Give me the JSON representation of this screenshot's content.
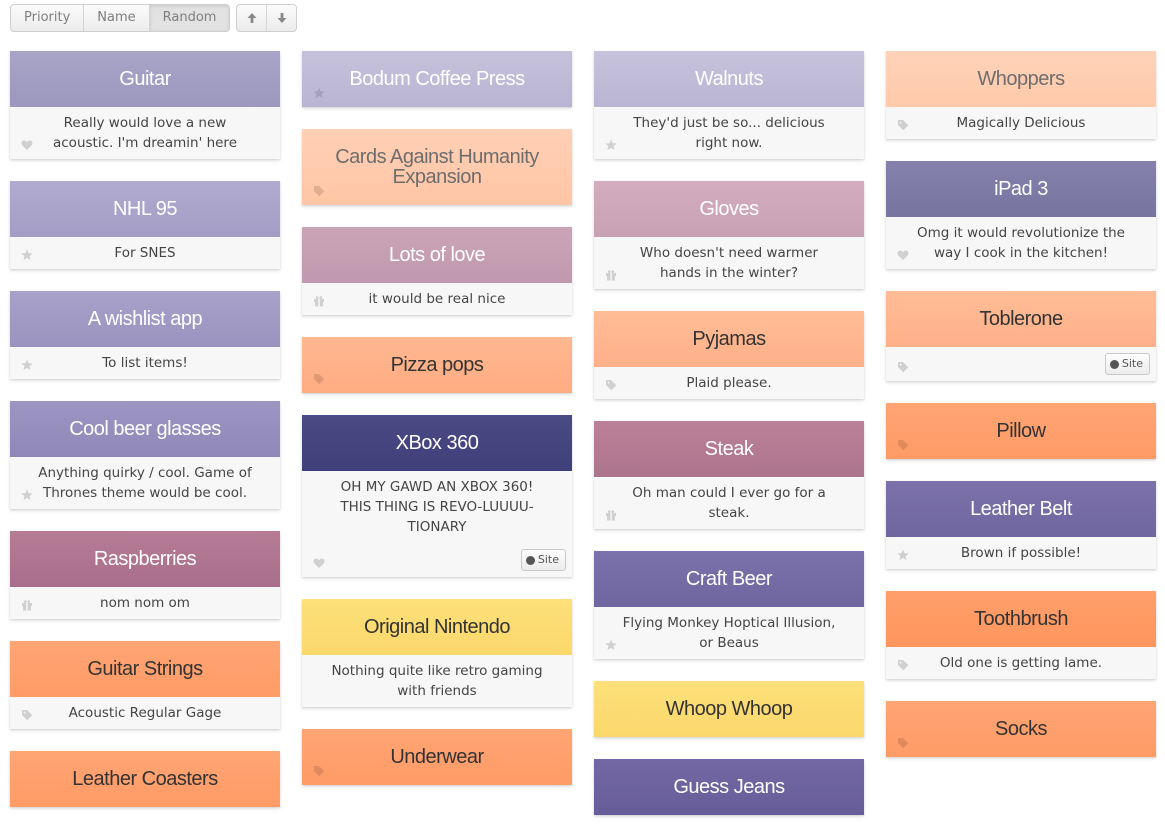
{
  "toolbar": {
    "sort_options": [
      "Priority",
      "Name",
      "Random"
    ],
    "active_sort": "Random",
    "direction_up_icon": "arrow-up-icon",
    "direction_down_icon": "arrow-down-icon"
  },
  "colors": {
    "violet_light": "#c4bfd8",
    "violet": "#a7a1c7",
    "mauve": "#cda7b9",
    "rose": "#b97a94",
    "peach_light": "#ffcdb0",
    "peach": "#ffb48b",
    "orange": "#ff9d6a",
    "yellow": "#fcdc72",
    "navy": "#45457d",
    "purple": "#7c6fa8"
  },
  "columns": [
    [
      {
        "title": "Guitar",
        "desc": "Really would love a new acoustic. I'm dreamin' here",
        "icon": "heart-icon"
      },
      {
        "title": "NHL 95",
        "desc": "For SNES",
        "icon": "star-icon"
      },
      {
        "title": "A wishlist app",
        "desc": "To list items!",
        "icon": "star-icon"
      },
      {
        "title": "Cool beer glasses",
        "desc": "Anything quirky / cool. Game of Thrones theme would be cool.",
        "icon": "star-icon"
      },
      {
        "title": "Raspberries",
        "desc": "nom nom om",
        "icon": "gift-icon"
      },
      {
        "title": "Guitar Strings",
        "desc": "Acoustic Regular Gage",
        "icon": "tag-icon"
      },
      {
        "title": "Leather Coasters",
        "desc": "",
        "icon": ""
      }
    ],
    [
      {
        "title": "Bodum Coffee Press",
        "desc": "",
        "icon": "star-icon"
      },
      {
        "title": "Cards Against Humanity Expansion",
        "desc": "",
        "icon": "tag-icon"
      },
      {
        "title": "Lots of love",
        "desc": "it would be real nice",
        "icon": "gift-icon"
      },
      {
        "title": "Pizza pops",
        "desc": "",
        "icon": "tag-icon"
      },
      {
        "title": "XBox 360",
        "desc": "OH MY GAWD AN XBOX 360! THIS THING IS REVO-LUUUU-TIONARY",
        "icon": "heart-icon",
        "site": "Site"
      },
      {
        "title": "Original Nintendo",
        "desc": "Nothing quite like retro gaming with friends",
        "icon": ""
      },
      {
        "title": "Underwear",
        "desc": "",
        "icon": "tag-icon"
      }
    ],
    [
      {
        "title": "Walnuts",
        "desc": "They'd just be so... delicious right now.",
        "icon": "star-icon"
      },
      {
        "title": "Gloves",
        "desc": "Who doesn't need warmer hands in the winter?",
        "icon": "gift-icon"
      },
      {
        "title": "Pyjamas",
        "desc": "Plaid please.",
        "icon": "tag-icon"
      },
      {
        "title": "Steak",
        "desc": "Oh man could I ever go for a steak.",
        "icon": "gift-icon"
      },
      {
        "title": "Craft Beer",
        "desc": "Flying Monkey Hoptical Illusion, or Beaus",
        "icon": "star-icon"
      },
      {
        "title": "Whoop Whoop",
        "desc": "",
        "icon": ""
      },
      {
        "title": "Guess Jeans",
        "desc": "",
        "icon": ""
      }
    ],
    [
      {
        "title": "Whoppers",
        "desc": "Magically Delicious",
        "icon": "tag-icon"
      },
      {
        "title": "iPad 3",
        "desc": "Omg it would revolutionize the way I cook in the kitchen!",
        "icon": "heart-icon"
      },
      {
        "title": "Toblerone",
        "desc": "",
        "icon": "tag-icon",
        "site": "Site"
      },
      {
        "title": "Pillow",
        "desc": "",
        "icon": "tag-icon"
      },
      {
        "title": "Leather Belt",
        "desc": "Brown if possible!",
        "icon": "star-icon"
      },
      {
        "title": "Toothbrush",
        "desc": "Old one is getting lame.",
        "icon": "tag-icon"
      },
      {
        "title": "Socks",
        "desc": "",
        "icon": "tag-icon"
      }
    ]
  ]
}
